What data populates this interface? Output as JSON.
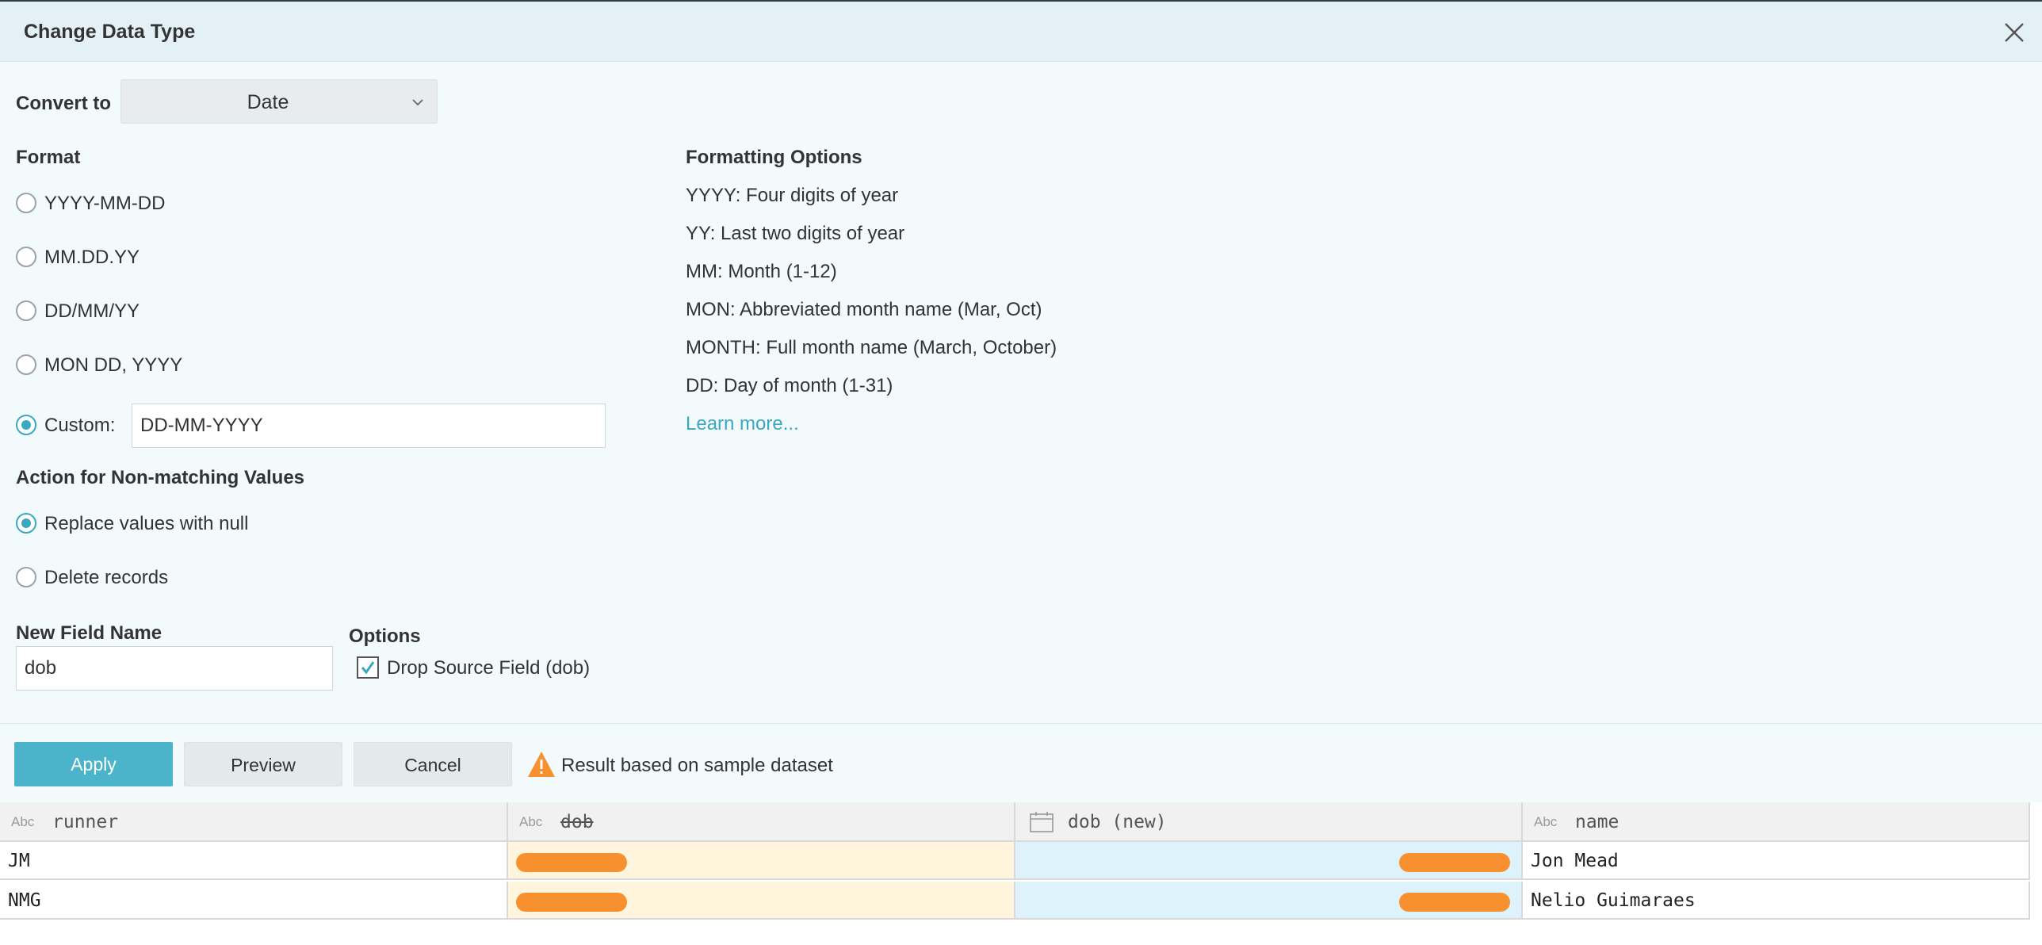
{
  "dialog": {
    "title": "Change Data Type"
  },
  "convert": {
    "label": "Convert to",
    "value": "Date"
  },
  "format": {
    "heading": "Format",
    "options": [
      "YYYY-MM-DD",
      "MM.DD.YY",
      "DD/MM/YY",
      "MON DD, YYYY"
    ],
    "custom_label": "Custom:",
    "custom_value": "DD-MM-YYYY",
    "selected": "custom"
  },
  "formatting_options": {
    "heading": "Formatting Options",
    "lines": [
      "YYYY: Four digits of year",
      "YY: Last two digits of year",
      "MM: Month (1-12)",
      "MON: Abbreviated month name (Mar, Oct)",
      "MONTH: Full month name (March, October)",
      "DD: Day of month (1-31)"
    ],
    "learn_more": "Learn more..."
  },
  "non_matching": {
    "heading": "Action for Non-matching Values",
    "options": [
      "Replace values with null",
      "Delete records"
    ],
    "selected": 0
  },
  "new_field": {
    "label": "New Field Name",
    "value": "dob"
  },
  "options": {
    "heading": "Options",
    "drop_source_label": "Drop Source Field (dob)",
    "drop_source_checked": true
  },
  "actions": {
    "apply": "Apply",
    "preview": "Preview",
    "cancel": "Cancel",
    "warning": "Result based on sample dataset"
  },
  "table": {
    "columns": [
      {
        "type": "Abc",
        "name": "runner"
      },
      {
        "type": "Abc",
        "name": "dob"
      },
      {
        "type": "calendar",
        "name": "dob (new)"
      },
      {
        "type": "Abc",
        "name": "name"
      }
    ],
    "rows": [
      {
        "runner": "JM",
        "name": "Jon Mead"
      },
      {
        "runner": "NMG",
        "name": "Nelio Guimaraes"
      }
    ]
  },
  "colors": {
    "accent": "#3aa8c1",
    "button": "#4bb4cb",
    "warning": "#f7902f"
  }
}
